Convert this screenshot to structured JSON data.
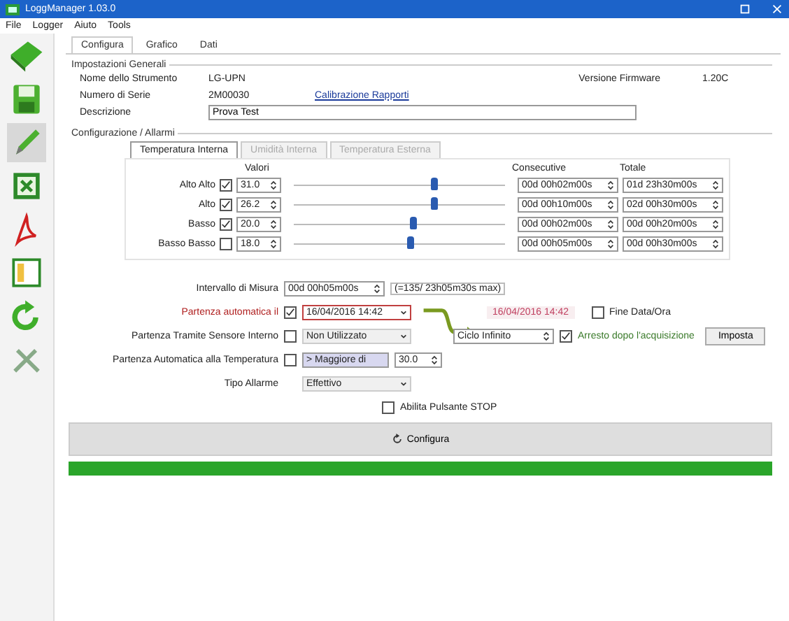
{
  "window": {
    "title": "LoggManager 1.03.0"
  },
  "menu": [
    "File",
    "Logger",
    "Aiuto",
    "Tools"
  ],
  "toolbar": [
    {
      "kind": "book"
    },
    {
      "kind": "save"
    },
    {
      "kind": "pencil"
    },
    {
      "kind": "sheet"
    },
    {
      "kind": "pdf"
    },
    {
      "kind": "panel"
    },
    {
      "kind": "refresh"
    },
    {
      "kind": "tools"
    }
  ],
  "tabs": [
    {
      "label": "Configura",
      "selected": true
    },
    {
      "label": "Grafico",
      "selected": false
    },
    {
      "label": "Dati",
      "selected": false
    }
  ],
  "general": {
    "title": "Impostazioni Generali",
    "name_label": "Nome dello Strumento",
    "name_value": "LG-UPN",
    "serial_label": "Numero di Serie",
    "serial_value": "2M00030",
    "calibration_link": "Calibrazione Rapporti",
    "description_label": "Descrizione",
    "description_value": "Prova Test",
    "firmware_label": "Versione Firmware",
    "firmware_value": "1.20C"
  },
  "alarms": {
    "title": "Configurazione / Allarmi",
    "channel_tabs": [
      {
        "label": "Temperatura Interna",
        "selected": true,
        "disabled": false
      },
      {
        "label": "Umidità Interna",
        "selected": false,
        "disabled": true
      },
      {
        "label": "Temperatura Esterna",
        "selected": false,
        "disabled": true
      }
    ],
    "values_header": "Valori",
    "consecutive_header": "Consecutive",
    "total_header": "Totale",
    "rows": [
      {
        "label": "Alto Alto",
        "checked": true,
        "value": "31.0",
        "level": 0.66,
        "consecutive": "00d 00h02m00s",
        "total": "01d 23h30m00s"
      },
      {
        "label": "Alto",
        "checked": true,
        "value": "26.2",
        "level": 0.66,
        "consecutive": "00d 00h10m00s",
        "total": "02d 00h30m00s"
      },
      {
        "label": "Basso",
        "checked": true,
        "value": "20.0",
        "level": 0.56,
        "consecutive": "00d 00h02m00s",
        "total": "00d 00h20m00s"
      },
      {
        "label": "Basso Basso",
        "checked": false,
        "value": "18.0",
        "level": 0.55,
        "consecutive": "00d 00h05m00s",
        "total": "00d 00h30m00s"
      }
    ]
  },
  "interval": {
    "label": "Intervallo di Misura",
    "value": "00d 00h05m00s",
    "note": "(=135/ 23h05m30s max)"
  },
  "start": {
    "auto_label": "Partenza automatica il",
    "auto_checked": true,
    "auto_value": "16/04/2016 14:42",
    "end_date": "16/04/2016 14:42",
    "end_label": "Fine Data/Ora",
    "end_checked": false,
    "cycle_value": "Ciclo Infinito",
    "stop_label": "Arresto dopo l'acquisizione",
    "stop_checked": true,
    "set_button": "Imposta",
    "sensor_label": "Partenza Tramite Sensore Interno",
    "sensor_checked": false,
    "sensor_value": "Non Utilizzato",
    "temp_label": "Partenza Automatica alla Temperatura",
    "temp_checked": false,
    "temp_mode": "> Maggiore di",
    "temp_value": "30.0",
    "alarm_label": "Tipo Allarme",
    "alarm_value": "Effettivo",
    "stop_button_label": "Abilita Pulsante STOP",
    "stop_button_checked": false
  },
  "configure_button": "Configura",
  "progress": {
    "level": 1
  }
}
